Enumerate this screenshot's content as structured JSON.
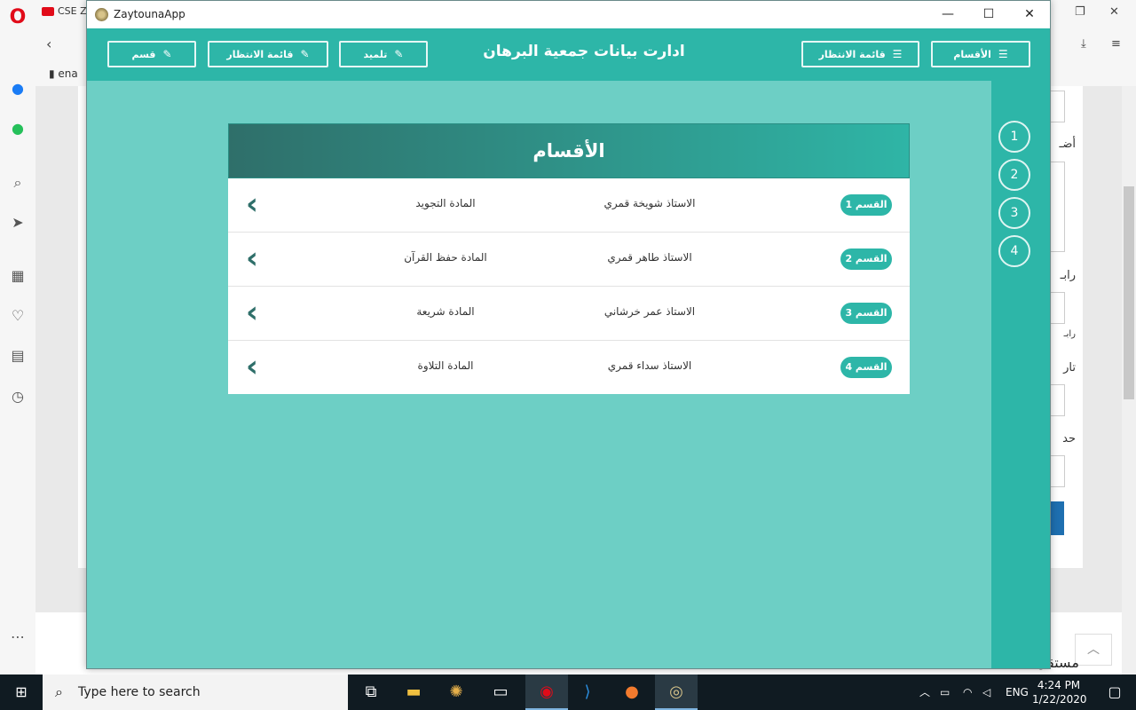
{
  "browser": {
    "tab_label": "CSE Z",
    "bookmark_label": "ena",
    "bottom_texts": [
      "مستقل"
    ],
    "right_form_labels": [
      "أضـ",
      "رابـ",
      "رابـ",
      "تار",
      "حد"
    ]
  },
  "app": {
    "window_title": "ZaytounaApp",
    "header_title": "ادارت بيانات جمعية البرهان",
    "header_buttons": {
      "sections": "الأقسام",
      "waiting_list_right": "قائمة الانتظار",
      "student": "تلميد",
      "waiting_list_left": "قائمة الانتظار",
      "section": "قسم"
    },
    "rail_numbers": [
      "1",
      "2",
      "3",
      "4"
    ],
    "panel_title": "الأقسام",
    "rows": [
      {
        "badge": "القسم 1",
        "teacher": "الاستاذ شويخة قمري",
        "subject": "المادة التجويد"
      },
      {
        "badge": "القسم 2",
        "teacher": "الاستاذ طاهر قمري",
        "subject": "المادة حفظ القرآن"
      },
      {
        "badge": "القسم 3",
        "teacher": "الاستاذ عمر خرشاني",
        "subject": "المادة شريعة"
      },
      {
        "badge": "القسم 4",
        "teacher": "الاستاذ سداء قمري",
        "subject": "المادة التلاوة"
      }
    ]
  },
  "taskbar": {
    "search_placeholder": "Type here to search",
    "language": "ENG",
    "time": "4:24 PM",
    "date": "1/22/2020"
  },
  "colors": {
    "accent": "#2db6a8",
    "main_bg": "#6dcfc5",
    "panel_header_dark": "#2f6f6a"
  }
}
